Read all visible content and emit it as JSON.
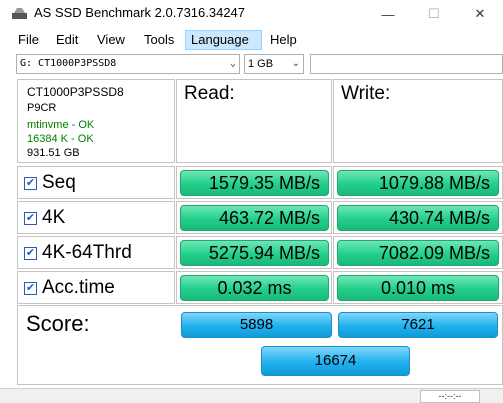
{
  "window": {
    "title": "AS SSD Benchmark 2.0.7316.34247",
    "minimize": "—",
    "maximize": "☐",
    "close": "✕"
  },
  "menu": {
    "items": [
      "File",
      "Edit",
      "View",
      "Tools",
      "Language",
      "Help"
    ],
    "active": "Language"
  },
  "toolbar": {
    "drive": "G: CT1000P3PSSD8",
    "size": "1 GB"
  },
  "drive_info": {
    "model": "CT1000P3PSSD8",
    "firmware": "P9CR",
    "driver": "mtinvme - OK",
    "alignment": "16384 K - OK",
    "capacity": "931.51 GB"
  },
  "headers": {
    "read": "Read:",
    "write": "Write:"
  },
  "tests": [
    {
      "label": "Seq",
      "checked": true,
      "read": "1579.35 MB/s",
      "write": "1079.88 MB/s"
    },
    {
      "label": "4K",
      "checked": true,
      "read": "463.72 MB/s",
      "write": "430.74 MB/s"
    },
    {
      "label": "4K-64Thrd",
      "checked": true,
      "read": "5275.94 MB/s",
      "write": "7082.09 MB/s"
    },
    {
      "label": "Acc.time",
      "checked": true,
      "read": "0.032 ms",
      "write": "0.010 ms"
    }
  ],
  "score": {
    "label": "Score:",
    "read": "5898",
    "write": "7621",
    "total": "16674"
  },
  "status": {
    "timer": "--:--:--"
  },
  "colors": {
    "result_green": "#22cf8a",
    "score_blue": "#1fb1ee",
    "ok_text": "#008000",
    "menu_highlight": "#cce8ff"
  }
}
